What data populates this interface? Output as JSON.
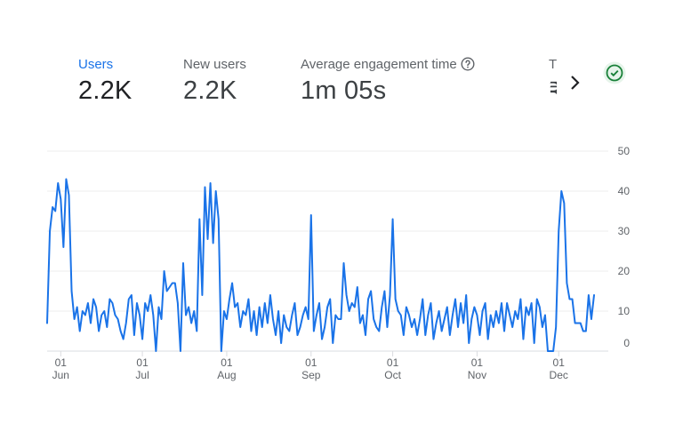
{
  "metrics": [
    {
      "label": "Users",
      "value": "2.2K",
      "active": true
    },
    {
      "label": "New users",
      "value": "2.2K",
      "active": false
    },
    {
      "label": "Average engagement time",
      "value": "1m 05s",
      "active": false
    },
    {
      "label": "T",
      "value": "₹",
      "active": false
    }
  ],
  "icons": {
    "help": "help-circle-icon",
    "next": "chevron-right-icon",
    "status": "check-circle-icon"
  },
  "colors": {
    "line": "#1a73e8",
    "accent": "#1a73e8",
    "status": "#188038"
  },
  "chart_data": {
    "type": "line",
    "ylim": [
      0,
      50
    ],
    "yticks": [
      0,
      10,
      20,
      30,
      40,
      50
    ],
    "y_axis_side": "right",
    "grid": true,
    "x_tick_labels": [
      {
        "day": "01",
        "month": "Jun",
        "index": 5
      },
      {
        "day": "01",
        "month": "Jul",
        "index": 35
      },
      {
        "day": "01",
        "month": "Aug",
        "index": 66
      },
      {
        "day": "01",
        "month": "Sep",
        "index": 97
      },
      {
        "day": "01",
        "month": "Oct",
        "index": 127
      },
      {
        "day": "01",
        "month": "Nov",
        "index": 158
      },
      {
        "day": "01",
        "month": "Dec",
        "index": 188
      }
    ],
    "series": [
      {
        "values": [
          7,
          30,
          36,
          35,
          42,
          38,
          26,
          43,
          39,
          15,
          8,
          11,
          5,
          10,
          9,
          12,
          7,
          13,
          11,
          5,
          9,
          10,
          6,
          13,
          12,
          9,
          8,
          5,
          3,
          7,
          13,
          14,
          4,
          12,
          9,
          3,
          12,
          10,
          14,
          9,
          0,
          11,
          8,
          20,
          15,
          16,
          17,
          17,
          12,
          0,
          22,
          9,
          11,
          7,
          10,
          5,
          33,
          14,
          41,
          28,
          42,
          27,
          40,
          33,
          0,
          10,
          8,
          13,
          17,
          11,
          12,
          6,
          10,
          9,
          13,
          5,
          10,
          4,
          11,
          6,
          12,
          7,
          14,
          8,
          4,
          10,
          2,
          9,
          6,
          5,
          9,
          12,
          4,
          6,
          9,
          11,
          8,
          34,
          5,
          9,
          12,
          3,
          6,
          11,
          13,
          2,
          9,
          8,
          8,
          22,
          14,
          10,
          12,
          11,
          16,
          7,
          9,
          4,
          13,
          15,
          8,
          6,
          5,
          11,
          15,
          6,
          14,
          33,
          13,
          10,
          9,
          4,
          11,
          9,
          6,
          8,
          4,
          8,
          13,
          4,
          9,
          12,
          3,
          7,
          10,
          5,
          8,
          11,
          4,
          9,
          13,
          6,
          12,
          7,
          14,
          2,
          8,
          11,
          9,
          4,
          10,
          12,
          3,
          9,
          6,
          10,
          7,
          12,
          5,
          12,
          9,
          6,
          10,
          8,
          13,
          3,
          11,
          9,
          12,
          2,
          13,
          11,
          6,
          9,
          0,
          0,
          0,
          6,
          30,
          40,
          37,
          17,
          13,
          13,
          7,
          7,
          7,
          5,
          5,
          14,
          8,
          14
        ]
      }
    ]
  }
}
